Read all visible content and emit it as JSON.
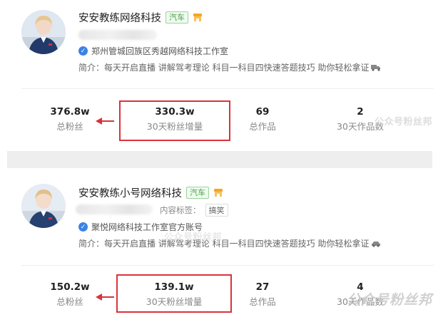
{
  "accounts": [
    {
      "name": "安安教练网络科技",
      "category_tag": "汽车",
      "verification": "郑州管城回族区秀越网络科技工作室",
      "intro": "简介：每天开启直播 讲解驾考理论 科目一科目四快速答题技巧 助你轻松拿证",
      "stats": [
        {
          "value": "376.8w",
          "label": "总粉丝"
        },
        {
          "value": "330.3w",
          "label": "30天粉丝增量"
        },
        {
          "value": "69",
          "label": "总作品"
        },
        {
          "value": "2",
          "label": "30天作品数"
        }
      ]
    },
    {
      "name": "安安教练小号网络科技",
      "category_tag": "汽车",
      "content_tag_label": "内容标签：",
      "content_tag": "搞笑",
      "verification": "聚悦网络科技工作室官方账号",
      "intro": "简介：每天开启直播 讲解驾考理论 科目一科目四快速答题技巧 助你轻松拿证",
      "stats": [
        {
          "value": "150.2w",
          "label": "总粉丝"
        },
        {
          "value": "139.1w",
          "label": "30天粉丝增量"
        },
        {
          "value": "27",
          "label": "总作品"
        },
        {
          "value": "4",
          "label": "30天作品数"
        }
      ]
    }
  ],
  "watermarks": {
    "small": "公众号粉丝邦",
    "big": "公众号粉丝邦"
  },
  "colors": {
    "highlight_red": "#d9333a",
    "car_tag_green": "#48a048",
    "verified_blue": "#3b82e6"
  },
  "icons": [
    "verified-badge-icon",
    "shop-icon",
    "truck-icon",
    "car-icon",
    "arrow-left-icon"
  ]
}
